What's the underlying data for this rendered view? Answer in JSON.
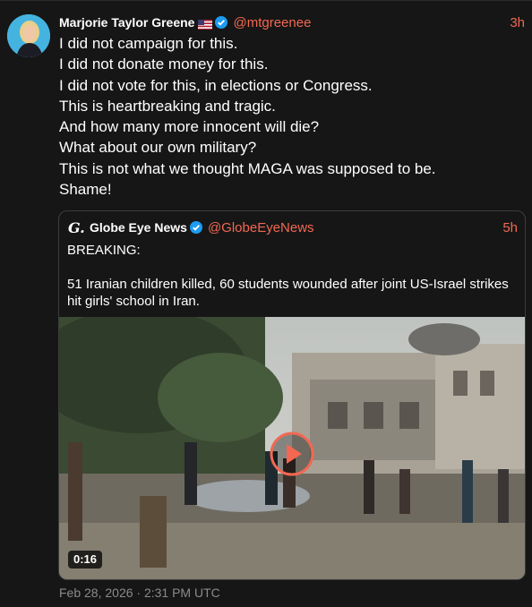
{
  "post": {
    "author_name": "Marjorie Taylor Greene",
    "flag_icon": "us-flag-icon",
    "verified_icon": "verified-badge-icon",
    "handle": "@mtgreenee",
    "time": "3h",
    "lines": [
      "I did not campaign for this.",
      "I did not donate money for this.",
      "I did not vote for this, in elections or Congress.",
      "This is heartbreaking and tragic.",
      "And how many more innocent will die?",
      "What about our own military?",
      "This is not what we thought MAGA was supposed to be.",
      "Shame!"
    ],
    "timestamp": "Feb 28, 2026 · 2:31 PM UTC"
  },
  "quote": {
    "logo": "G.",
    "author_name": "Globe Eye News",
    "handle": "@GlobeEyeNews",
    "time": "5h",
    "text_line1": "BREAKING:",
    "text_line2": "51 Iranian children killed, 60 students wounded after joint US-Israel strikes hit girls' school in Iran.",
    "video": {
      "duration": "0:16",
      "play_icon": "play-button-icon"
    }
  },
  "colors": {
    "accent": "#f26852",
    "background": "#161616",
    "verified": "#1d9bf0"
  }
}
